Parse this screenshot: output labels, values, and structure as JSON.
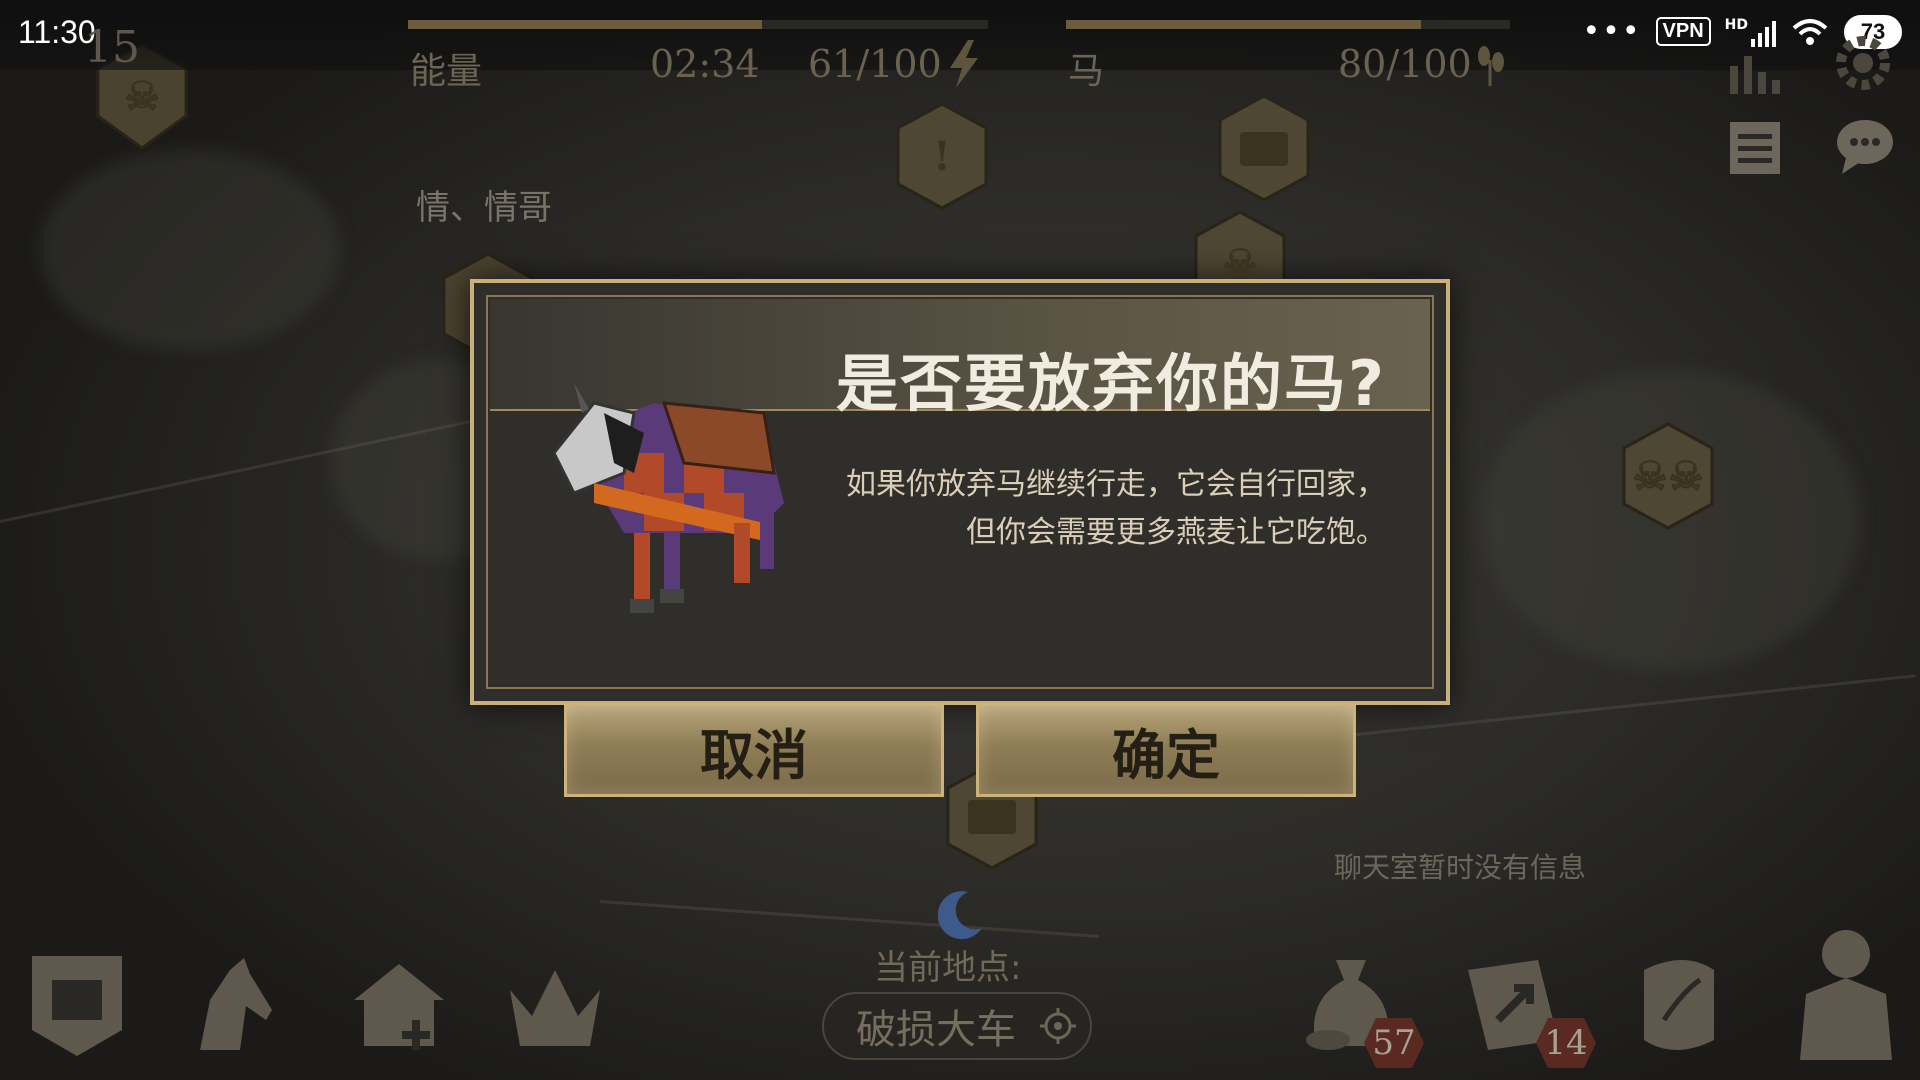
{
  "status_bar": {
    "time": "11:30",
    "vpn_label": "VPN",
    "network_label": "HD",
    "battery": "73"
  },
  "hud": {
    "day_number": "15",
    "energy": {
      "label": "能量",
      "timer": "02:34",
      "value": "61/100",
      "fraction": 0.61
    },
    "horse": {
      "label": "马",
      "value": "80/100",
      "fraction": 0.8
    }
  },
  "map": {
    "location_text": "情、情哥"
  },
  "dialog": {
    "title": "是否要放弃你的马?",
    "message_line1": "如果你放弃马继续行走，它会自行回家，",
    "message_line2": "但你会需要更多燕麦让它吃饱。",
    "cancel_label": "取消",
    "confirm_label": "确定"
  },
  "bottom": {
    "chat_empty": "聊天室暂时没有信息",
    "current_location_label": "当前地点:",
    "current_location": "破损大车",
    "inventory_count": "57",
    "map_count": "14"
  },
  "colors": {
    "gold_border": "#c9b07a",
    "button_gold": "#a08e64",
    "panel_bg": "#2f2e2a"
  }
}
